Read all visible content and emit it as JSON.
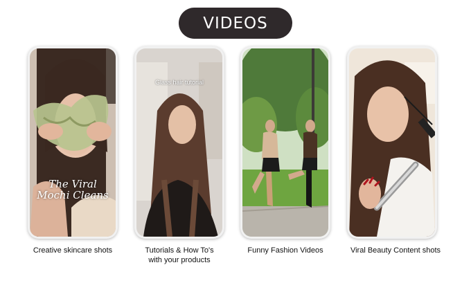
{
  "header": {
    "title": "VIDEOS"
  },
  "cards": [
    {
      "overlay_line1": "The Viral",
      "overlay_line2": "Mochi Cleans",
      "caption_line1": "Creative skincare shots",
      "caption_line2": ""
    },
    {
      "overlay": "Glass hair tutorial",
      "caption_line1": "Tutorials & How To's",
      "caption_line2": "with your products"
    },
    {
      "caption_line1": "Funny Fashion Videos",
      "caption_line2": ""
    },
    {
      "caption_line1": "Viral Beauty Content shots",
      "caption_line2": ""
    }
  ]
}
